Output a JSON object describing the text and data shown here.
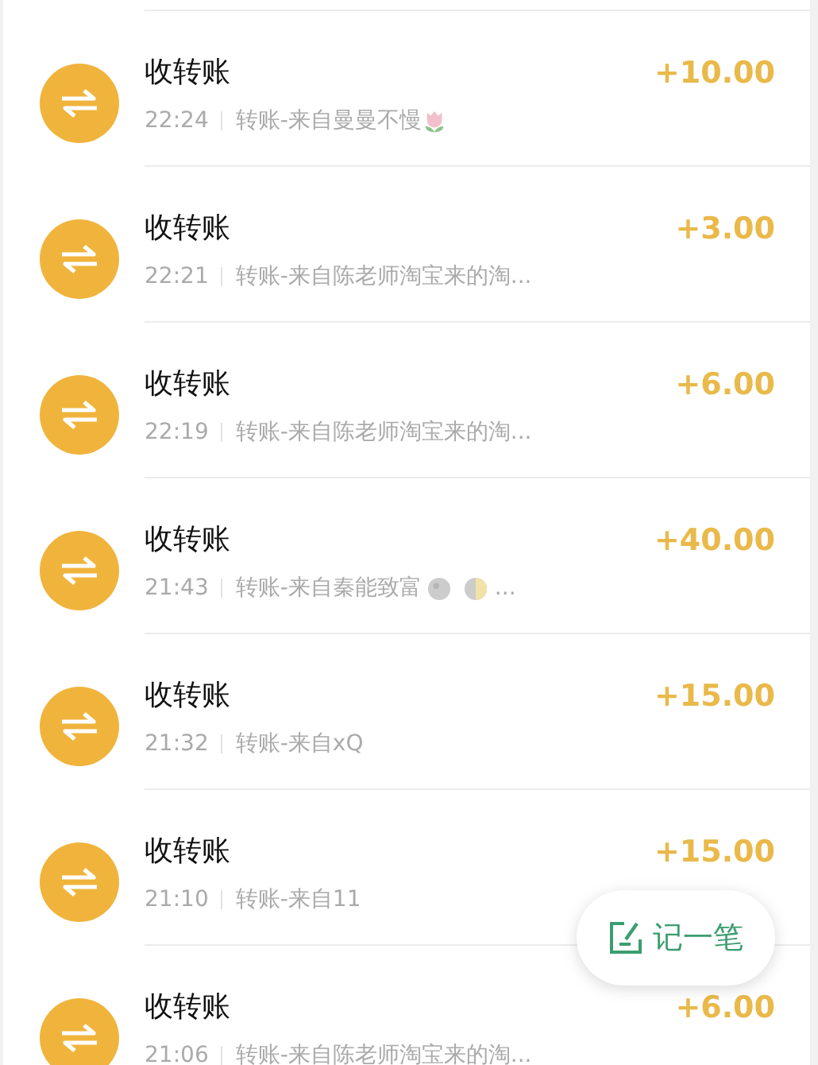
{
  "transactions": [
    {
      "title": "收转账",
      "time": "22:24",
      "description": [
        {
          "kind": "text",
          "text": "转账-来自曼曼不慢"
        },
        {
          "kind": "tulip"
        }
      ],
      "amount": "+10.00"
    },
    {
      "title": "收转账",
      "time": "22:21",
      "description": [
        {
          "kind": "text",
          "text": "转账-来自陈老师淘宝来的淘..."
        }
      ],
      "amount": "+3.00"
    },
    {
      "title": "收转账",
      "time": "22:19",
      "description": [
        {
          "kind": "text",
          "text": "转账-来自陈老师淘宝来的淘..."
        }
      ],
      "amount": "+6.00"
    },
    {
      "title": "收转账",
      "time": "21:43",
      "description": [
        {
          "kind": "text",
          "text": "转账-来自秦能致富"
        },
        {
          "kind": "full-moon"
        },
        {
          "kind": "half-moon"
        },
        {
          "kind": "text",
          "text": "..."
        }
      ],
      "amount": "+40.00"
    },
    {
      "title": "收转账",
      "time": "21:32",
      "description": [
        {
          "kind": "text",
          "text": "转账-来自xQ"
        }
      ],
      "amount": "+15.00"
    },
    {
      "title": "收转账",
      "time": "21:10",
      "description": [
        {
          "kind": "text",
          "text": "转账-来自11"
        }
      ],
      "amount": "+15.00"
    },
    {
      "title": "收转账",
      "time": "21:06",
      "description": [
        {
          "kind": "text",
          "text": "转账-来自陈老师淘宝来的淘..."
        }
      ],
      "amount": "+6.00"
    }
  ],
  "fab": {
    "label": "记一笔"
  }
}
